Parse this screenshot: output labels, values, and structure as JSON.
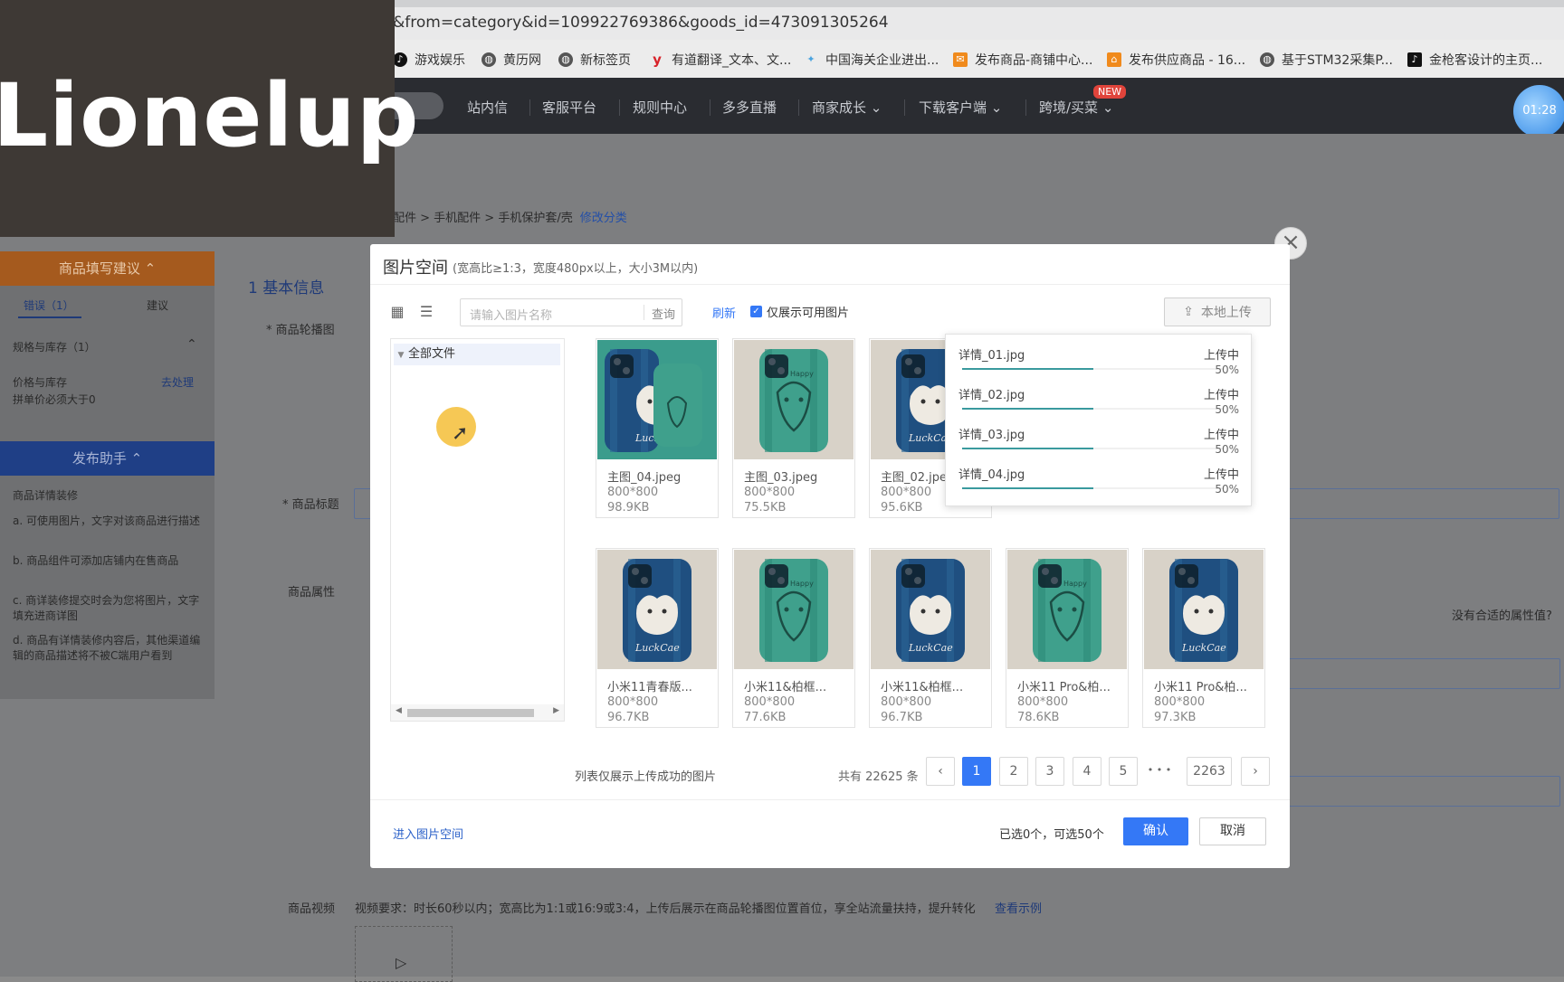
{
  "browser": {
    "url": "&from=category&id=109922769386&goods_id=473091305264",
    "bookmarks": [
      "游戏娱乐",
      "黄历网",
      "新标签页",
      "有道翻译_文本、文...",
      "中国海关企业进出...",
      "发布商品-商铺中心...",
      "发布供应商品 - 16...",
      "基于STM32采集P...",
      "金枪客设计的主页..."
    ]
  },
  "topnav": {
    "items": [
      "站内信",
      "客服平台",
      "规则中心",
      "多多直播",
      "商家成长",
      "下载客户端",
      "跨境/买菜"
    ],
    "new_badge": "NEW",
    "timer": "01:28"
  },
  "video_overlay": {
    "text": "Lionelup"
  },
  "page": {
    "breadcrumb": "配件 > 手机配件 > 手机保护套/壳",
    "breadcrumb_link": "修改分类",
    "section_title": "1 基本信息",
    "labels": {
      "carousel": "* 商品轮播图",
      "title": "* 商品标题",
      "attrs": "商品属性",
      "video": "商品视频",
      "no_attr": "没有合适的属性值?"
    },
    "video_req": "视频要求：时长60秒以内；宽高比为1:1或16:9或3:4，上传后展示在商品轮播图位置首位，享全站流量扶持，提升转化",
    "video_example": "查看示例"
  },
  "left_panel": {
    "suggest_head": "商品填写建议",
    "tab_error": "错误（1）",
    "tab_suggest": "建议",
    "group": "规格与库存（1）",
    "item_title": "价格与库存",
    "item_action": "去处理",
    "item_desc": "拼单价必须大于0",
    "assistant_head": "发布助手",
    "assistant_title": "商品详情装修",
    "tips": [
      "a. 可使用图片，文字对该商品进行描述",
      "b. 商品组件可添加店铺内在售商品",
      "c. 商详装修提交时会为您将图片，文字填充进商详图",
      "d. 商品有详情装修内容后，其他渠道编辑的商品描述将不被C端用户看到"
    ]
  },
  "modal": {
    "title": "图片空间",
    "subtitle": "(宽高比≥1:3，宽度480px以上，大小3M以内)",
    "search_placeholder": "请输入图片名称",
    "search_btn": "查询",
    "refresh": "刷新",
    "only_available": "仅展示可用图片",
    "upload_btn": "本地上传",
    "folder_all": "全部文件",
    "uploads": [
      {
        "name": "详情_01.jpg",
        "status": "上传中",
        "percent": "50%",
        "progress": 0.5
      },
      {
        "name": "详情_02.jpg",
        "status": "上传中",
        "percent": "50%",
        "progress": 0.5
      },
      {
        "name": "详情_03.jpg",
        "status": "上传中",
        "percent": "50%",
        "progress": 0.5
      },
      {
        "name": "详情_04.jpg",
        "status": "上传中",
        "percent": "50%",
        "progress": 0.5
      }
    ],
    "images_row1": [
      {
        "name": "主图_04.jpeg",
        "dim": "800*800",
        "size": "98.9KB",
        "style": "blue-green"
      },
      {
        "name": "主图_03.jpeg",
        "dim": "800*800",
        "size": "75.5KB",
        "style": "green"
      },
      {
        "name": "主图_02.jpeg",
        "dim": "800*800",
        "size": "95.6KB",
        "style": "blue"
      }
    ],
    "images_row2": [
      {
        "name": "小米11青春版...",
        "dim": "800*800",
        "size": "96.7KB",
        "style": "blue"
      },
      {
        "name": "小米11&柏框...",
        "dim": "800*800",
        "size": "77.6KB",
        "style": "green"
      },
      {
        "name": "小米11&柏框...",
        "dim": "800*800",
        "size": "96.7KB",
        "style": "blue"
      },
      {
        "name": "小米11 Pro&柏...",
        "dim": "800*800",
        "size": "78.6KB",
        "style": "green"
      },
      {
        "name": "小米11 Pro&柏...",
        "dim": "800*800",
        "size": "97.3KB",
        "style": "blue"
      }
    ],
    "list_note": "列表仅展示上传成功的图片",
    "total": "共有 22625 条",
    "pages": [
      "1",
      "2",
      "3",
      "4",
      "5",
      "• • •",
      "2263"
    ],
    "enter_space": "进入图片空间",
    "selected_info": "已选0个，可选50个",
    "confirm": "确认",
    "cancel": "取消"
  }
}
